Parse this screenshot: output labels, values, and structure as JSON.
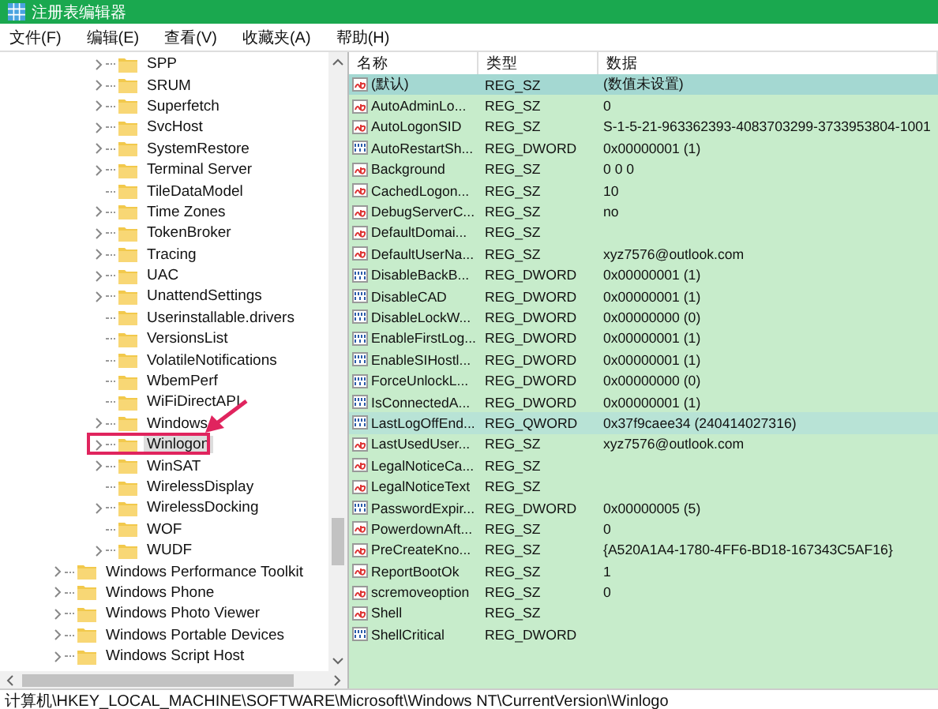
{
  "window": {
    "title": "注册表编辑器"
  },
  "menu": [
    "文件(F)",
    "编辑(E)",
    "查看(V)",
    "收藏夹(A)",
    "帮助(H)"
  ],
  "tree": {
    "inner_items": [
      {
        "label": "SPP",
        "expandable": true,
        "selected": false
      },
      {
        "label": "SRUM",
        "expandable": true,
        "selected": false
      },
      {
        "label": "Superfetch",
        "expandable": true,
        "selected": false
      },
      {
        "label": "SvcHost",
        "expandable": true,
        "selected": false
      },
      {
        "label": "SystemRestore",
        "expandable": true,
        "selected": false
      },
      {
        "label": "Terminal Server",
        "expandable": true,
        "selected": false
      },
      {
        "label": "TileDataModel",
        "expandable": false,
        "selected": false
      },
      {
        "label": "Time Zones",
        "expandable": true,
        "selected": false
      },
      {
        "label": "TokenBroker",
        "expandable": true,
        "selected": false
      },
      {
        "label": "Tracing",
        "expandable": true,
        "selected": false
      },
      {
        "label": "UAC",
        "expandable": true,
        "selected": false
      },
      {
        "label": "UnattendSettings",
        "expandable": true,
        "selected": false
      },
      {
        "label": "Userinstallable.drivers",
        "expandable": false,
        "selected": false
      },
      {
        "label": "VersionsList",
        "expandable": false,
        "selected": false
      },
      {
        "label": "VolatileNotifications",
        "expandable": false,
        "selected": false
      },
      {
        "label": "WbemPerf",
        "expandable": false,
        "selected": false
      },
      {
        "label": "WiFiDirectAPI",
        "expandable": false,
        "selected": false
      },
      {
        "label": "Windows",
        "expandable": true,
        "selected": false
      },
      {
        "label": "Winlogon",
        "expandable": true,
        "selected": true
      },
      {
        "label": "WinSAT",
        "expandable": true,
        "selected": false
      },
      {
        "label": "WirelessDisplay",
        "expandable": false,
        "selected": false
      },
      {
        "label": "WirelessDocking",
        "expandable": true,
        "selected": false
      },
      {
        "label": "WOF",
        "expandable": false,
        "selected": false
      },
      {
        "label": "WUDF",
        "expandable": true,
        "selected": false
      }
    ],
    "outer_items": [
      {
        "label": "Windows Performance Toolkit",
        "expandable": true,
        "selected": false
      },
      {
        "label": "Windows Phone",
        "expandable": true,
        "selected": false
      },
      {
        "label": "Windows Photo Viewer",
        "expandable": true,
        "selected": false
      },
      {
        "label": "Windows Portable Devices",
        "expandable": true,
        "selected": false
      },
      {
        "label": "Windows Script Host",
        "expandable": true,
        "selected": false
      }
    ]
  },
  "table": {
    "columns": [
      "名称",
      "类型",
      "数据"
    ],
    "rows": [
      {
        "kind": "string",
        "name": "(默认)",
        "type": "REG_SZ",
        "data": "(数值未设置)",
        "selected": true,
        "highlighted": false
      },
      {
        "kind": "string",
        "name": "AutoAdminLo...",
        "type": "REG_SZ",
        "data": "0",
        "selected": false,
        "highlighted": false
      },
      {
        "kind": "string",
        "name": "AutoLogonSID",
        "type": "REG_SZ",
        "data": "S-1-5-21-963362393-4083703299-3733953804-1001",
        "selected": false,
        "highlighted": false
      },
      {
        "kind": "binary",
        "name": "AutoRestartSh...",
        "type": "REG_DWORD",
        "data": "0x00000001 (1)",
        "selected": false,
        "highlighted": false
      },
      {
        "kind": "string",
        "name": "Background",
        "type": "REG_SZ",
        "data": "0 0 0",
        "selected": false,
        "highlighted": false
      },
      {
        "kind": "string",
        "name": "CachedLogon...",
        "type": "REG_SZ",
        "data": "10",
        "selected": false,
        "highlighted": false
      },
      {
        "kind": "string",
        "name": "DebugServerC...",
        "type": "REG_SZ",
        "data": "no",
        "selected": false,
        "highlighted": false
      },
      {
        "kind": "string",
        "name": "DefaultDomai...",
        "type": "REG_SZ",
        "selected": false,
        "highlighted": false
      },
      {
        "kind": "string",
        "name": "DefaultUserNa...",
        "type": "REG_SZ",
        "data": "xyz7576@outlook.com",
        "selected": false,
        "highlighted": false
      },
      {
        "kind": "binary",
        "name": "DisableBackB...",
        "type": "REG_DWORD",
        "data": "0x00000001 (1)",
        "selected": false,
        "highlighted": false
      },
      {
        "kind": "binary",
        "name": "DisableCAD",
        "type": "REG_DWORD",
        "data": "0x00000001 (1)",
        "selected": false,
        "highlighted": false
      },
      {
        "kind": "binary",
        "name": "DisableLockW...",
        "type": "REG_DWORD",
        "data": "0x00000000 (0)",
        "selected": false,
        "highlighted": false
      },
      {
        "kind": "binary",
        "name": "EnableFirstLog...",
        "type": "REG_DWORD",
        "data": "0x00000001 (1)",
        "selected": false,
        "highlighted": false
      },
      {
        "kind": "binary",
        "name": "EnableSIHostl...",
        "type": "REG_DWORD",
        "data": "0x00000001 (1)",
        "selected": false,
        "highlighted": false
      },
      {
        "kind": "binary",
        "name": "ForceUnlockL...",
        "type": "REG_DWORD",
        "data": "0x00000000 (0)",
        "selected": false,
        "highlighted": false
      },
      {
        "kind": "binary",
        "name": "IsConnectedA...",
        "type": "REG_DWORD",
        "data": "0x00000001 (1)",
        "selected": false,
        "highlighted": false
      },
      {
        "kind": "binary",
        "name": "LastLogOffEnd...",
        "type": "REG_QWORD",
        "data": "0x37f9caee34 (240414027316)",
        "selected": false,
        "highlighted": true
      },
      {
        "kind": "string",
        "name": "LastUsedUser...",
        "type": "REG_SZ",
        "data": "xyz7576@outlook.com",
        "selected": false,
        "highlighted": false
      },
      {
        "kind": "string",
        "name": "LegalNoticeCa...",
        "type": "REG_SZ",
        "selected": false,
        "highlighted": false
      },
      {
        "kind": "string",
        "name": "LegalNoticeText",
        "type": "REG_SZ",
        "selected": false,
        "highlighted": false
      },
      {
        "kind": "binary",
        "name": "PasswordExpir...",
        "type": "REG_DWORD",
        "data": "0x00000005 (5)",
        "selected": false,
        "highlighted": false
      },
      {
        "kind": "string",
        "name": "PowerdownAft...",
        "type": "REG_SZ",
        "data": "0",
        "selected": false,
        "highlighted": false
      },
      {
        "kind": "string",
        "name": "PreCreateKno...",
        "type": "REG_SZ",
        "data": "{A520A1A4-1780-4FF6-BD18-167343C5AF16}",
        "selected": false,
        "highlighted": false
      },
      {
        "kind": "string",
        "name": "ReportBootOk",
        "type": "REG_SZ",
        "data": "1",
        "selected": false,
        "highlighted": false
      },
      {
        "kind": "string",
        "name": "scremoveoption",
        "type": "REG_SZ",
        "data": "0",
        "selected": false,
        "highlighted": false
      },
      {
        "kind": "string",
        "name": "Shell",
        "type": "REG_SZ",
        "selected": false,
        "highlighted": false
      },
      {
        "kind": "binary",
        "name": "ShellCritical",
        "type": "REG_DWORD",
        "selected": false,
        "highlighted": false
      }
    ]
  },
  "status_bar": "计算机\\HKEY_LOCAL_MACHINE\\SOFTWARE\\Microsoft\\Windows NT\\CurrentVersion\\Winlogo"
}
